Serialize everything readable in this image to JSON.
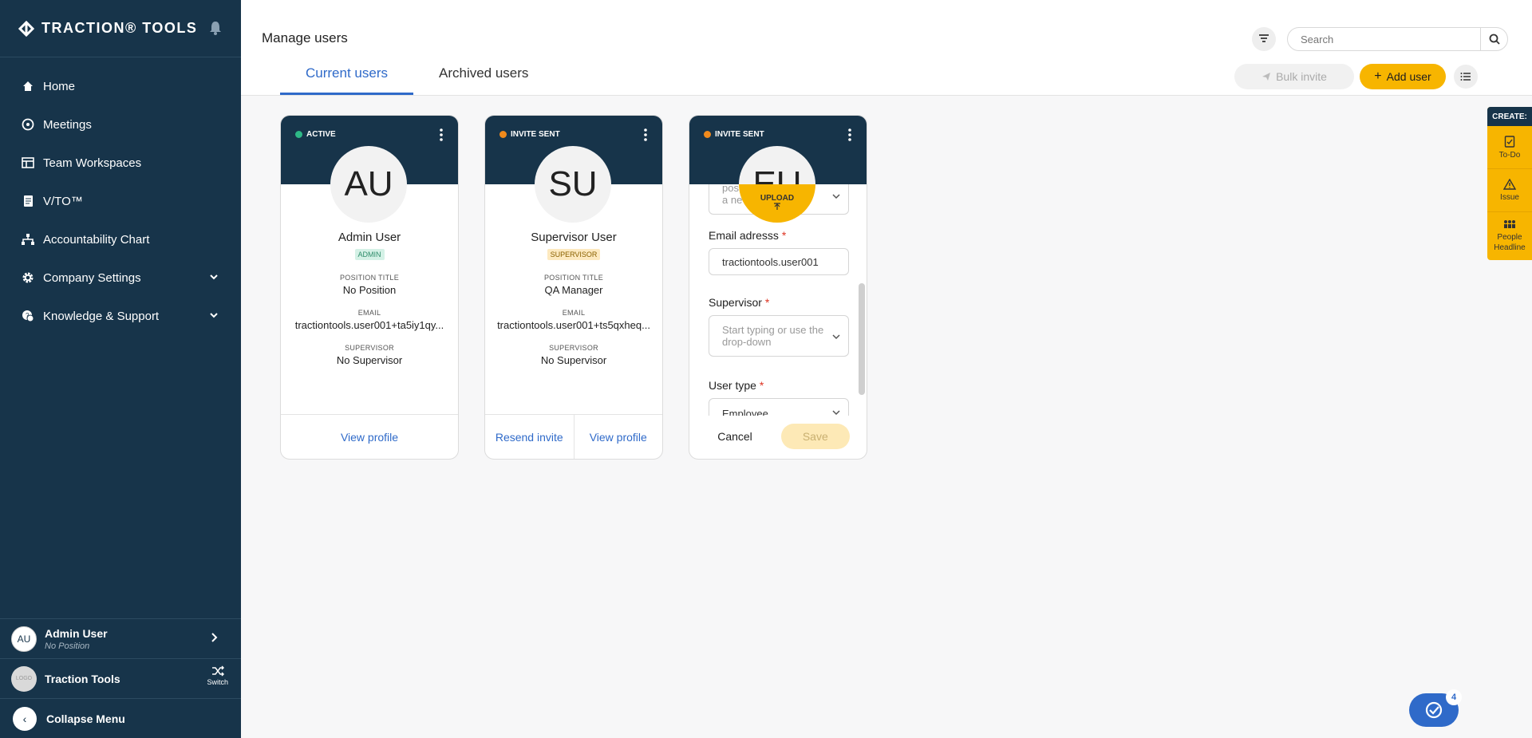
{
  "brand": {
    "name": "TRACTION® TOOLS"
  },
  "sidebar": {
    "items": [
      {
        "label": "Home",
        "icon": "home-icon"
      },
      {
        "label": "Meetings",
        "icon": "meetings-icon"
      },
      {
        "label": "Team Workspaces",
        "icon": "workspace-icon"
      },
      {
        "label": "V/TO™",
        "icon": "document-icon"
      },
      {
        "label": "Accountability Chart",
        "icon": "org-chart-icon"
      },
      {
        "label": "Company Settings",
        "icon": "gear-icon"
      },
      {
        "label": "Knowledge & Support",
        "icon": "support-icon"
      }
    ],
    "user": {
      "initials": "AU",
      "name": "Admin User",
      "position": "No Position"
    },
    "org": {
      "logo_text": "LOGO",
      "name": "Traction Tools",
      "switch_label": "Switch"
    },
    "collapse_label": "Collapse Menu"
  },
  "header": {
    "title": "Manage users",
    "tabs": [
      {
        "label": "Current users"
      },
      {
        "label": "Archived users"
      }
    ],
    "search_placeholder": "Search",
    "bulk_invite_label": "Bulk invite",
    "add_user_label": "Add user"
  },
  "cards": [
    {
      "status": "ACTIVE",
      "status_color": "#2eb886",
      "initials": "AU",
      "name": "Admin User",
      "role": "ADMIN",
      "position_label": "POSITION TITLE",
      "position": "No Position",
      "email_label": "EMAIL",
      "email": "tractiontools.user001+ta5iy1qy...",
      "supervisor_label": "SUPERVISOR",
      "supervisor": "No Supervisor",
      "view_profile": "View profile"
    },
    {
      "status": "INVITE SENT",
      "status_color": "#f08a1c",
      "initials": "SU",
      "name": "Supervisor User",
      "role": "SUPERVISOR",
      "position_label": "POSITION TITLE",
      "position": "QA Manager",
      "email_label": "EMAIL",
      "email": "tractiontools.user001+ts5qxheq...",
      "supervisor_label": "SUPERVISOR",
      "supervisor": "No Supervisor",
      "resend_invite": "Resend invite",
      "view_profile": "View profile"
    }
  ],
  "edit_card": {
    "status": "INVITE SENT",
    "status_color": "#f08a1c",
    "initials": "EU",
    "upload_label": "UPLOAD",
    "position_placeholder_fragment": "pos\na ne",
    "email_label": "Email adresss",
    "email_value": "tractiontools.user001",
    "supervisor_label": "Supervisor",
    "supervisor_placeholder": "Start typing or use the drop-down",
    "user_type_label": "User type",
    "user_type_value": "Employee",
    "required_mark": "*",
    "cancel_label": "Cancel",
    "save_label": "Save"
  },
  "create_panel": {
    "title": "CREATE:",
    "items": [
      {
        "label": "To-Do"
      },
      {
        "label": "Issue"
      },
      {
        "label": "People Headline"
      }
    ]
  },
  "fab": {
    "count": "4"
  },
  "colors": {
    "sidebar": "#17344a",
    "accent": "#2f6ac9",
    "brand_yellow": "#f7b500"
  }
}
